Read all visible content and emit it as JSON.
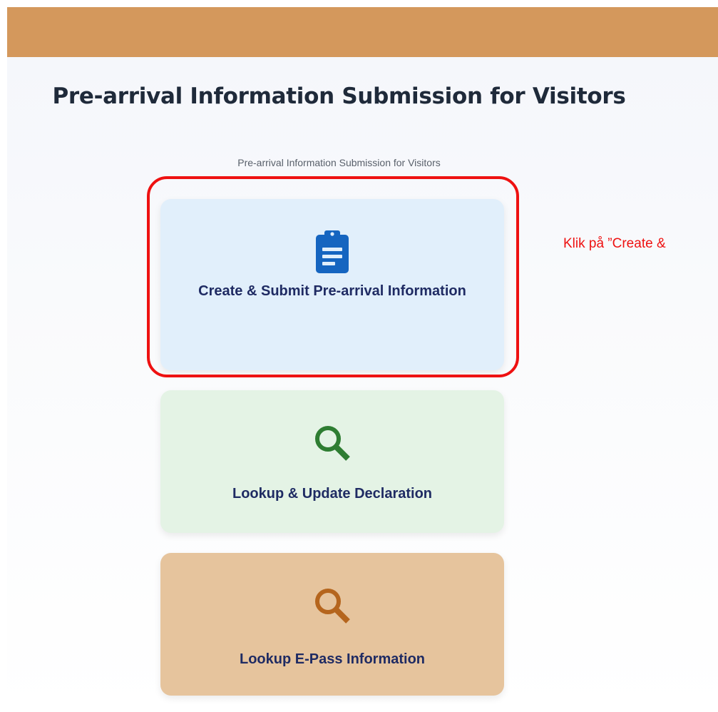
{
  "header": {
    "bar_color": "#d4985c",
    "title": "Pre-arrival Information Submission for Visitors",
    "subtitle": "Pre-arrival Information Submission for Visitors"
  },
  "cards": [
    {
      "label": "Create & Submit Pre-arrival Information",
      "icon": "clipboard-icon",
      "background": "#e1effb",
      "icon_color": "#1565c0"
    },
    {
      "label": "Lookup & Update Declaration",
      "icon": "search-icon",
      "background": "#e4f3e5",
      "icon_color": "#2e7d32"
    },
    {
      "label": "Lookup E-Pass Information",
      "icon": "search-icon",
      "background": "#e6c49d",
      "icon_color": "#b5651d"
    }
  ],
  "annotation": {
    "text": "Klik på ”Create &",
    "color": "#ee1111"
  }
}
